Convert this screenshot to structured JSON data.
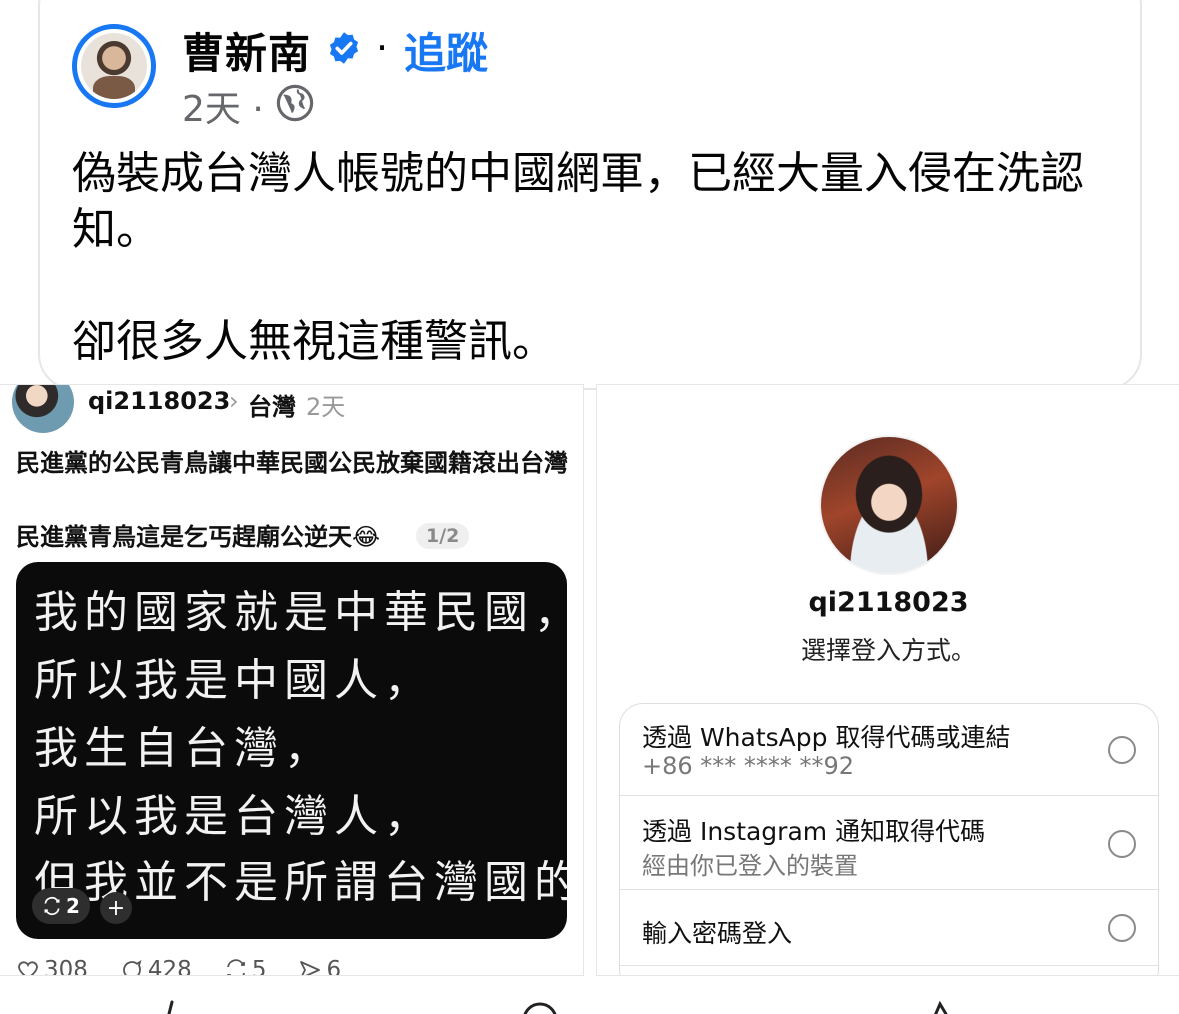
{
  "post": {
    "author": "曹新南",
    "separator": "·",
    "follow_label": "追蹤",
    "time": "2天 ·",
    "body": "偽裝成台灣人帳號的中國網軍，已經大量入侵在洗認\n知。\n\n卻很多人無視這種警訊。",
    "accent_color": "#1877f2"
  },
  "left_screenshot": {
    "username": "qi2118023",
    "chevron": "›",
    "topic": "台灣",
    "time": "2天",
    "text_line1": "民進黨的公民青鳥讓中華民國公民放棄國籍滾出台灣",
    "text_line2": "民進黨青鳥這是乞丐趕廟公逆天😂",
    "page_indicator": "1/2",
    "image_lines": [
      "我的國家就是中華民國，",
      "所以我是中國人，",
      "我生自台灣，",
      "所以我是台灣人，",
      "但我並不是所謂台灣國的人"
    ],
    "repost_count_pill": "2",
    "plus_label": "+",
    "actions": {
      "likes": "308",
      "comments": "428",
      "reposts": "5",
      "shares": "6"
    }
  },
  "right_screenshot": {
    "username": "qi2118023",
    "subtitle": "選擇登入方式。",
    "options": [
      {
        "title": "透過 WhatsApp 取得代碼或連結",
        "subtitle": "+86 *** **** **92"
      },
      {
        "title": "透過 Instagram 通知取得代碼",
        "subtitle": "經由你已登入的裝置"
      },
      {
        "title": "輸入密碼登入",
        "subtitle": ""
      }
    ]
  }
}
